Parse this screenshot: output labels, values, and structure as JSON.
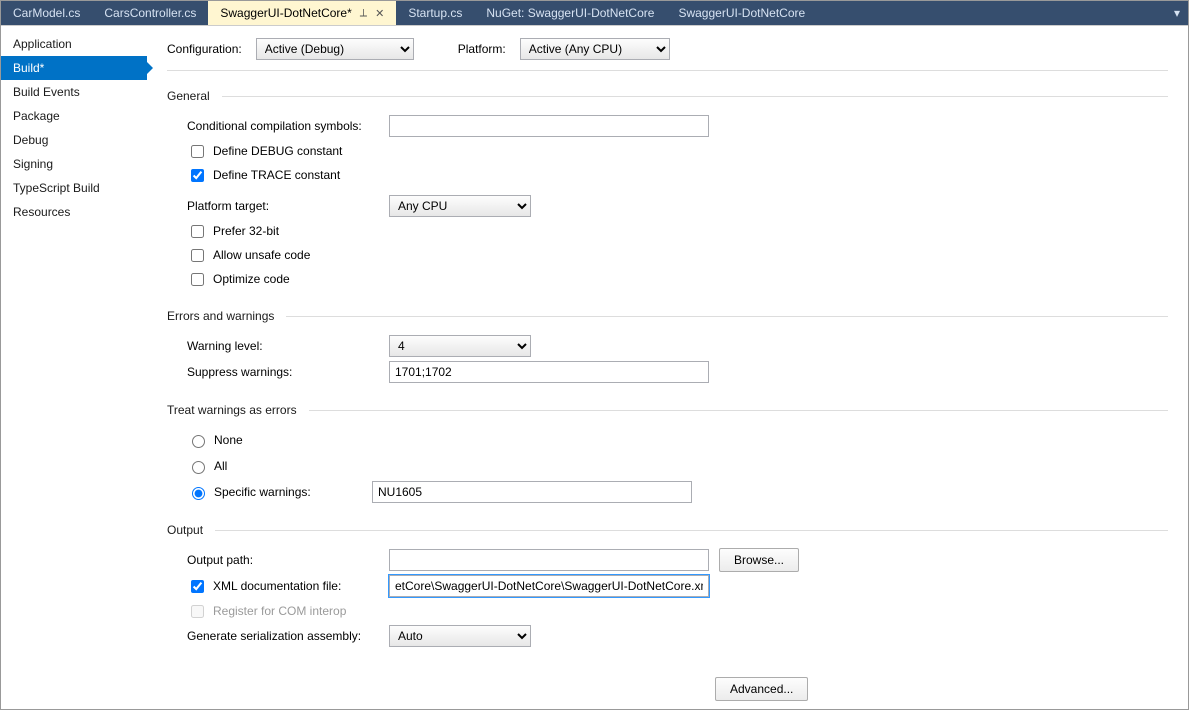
{
  "tabs": [
    {
      "label": "CarModel.cs",
      "active": false
    },
    {
      "label": "CarsController.cs",
      "active": false
    },
    {
      "label": "SwaggerUI-DotNetCore*",
      "active": true
    },
    {
      "label": "Startup.cs",
      "active": false
    },
    {
      "label": "NuGet: SwaggerUI-DotNetCore",
      "active": false
    },
    {
      "label": "SwaggerUI-DotNetCore",
      "active": false
    }
  ],
  "sidebar": {
    "items": [
      {
        "label": "Application",
        "active": false
      },
      {
        "label": "Build*",
        "active": true
      },
      {
        "label": "Build Events",
        "active": false
      },
      {
        "label": "Package",
        "active": false
      },
      {
        "label": "Debug",
        "active": false
      },
      {
        "label": "Signing",
        "active": false
      },
      {
        "label": "TypeScript Build",
        "active": false
      },
      {
        "label": "Resources",
        "active": false
      }
    ]
  },
  "top": {
    "configuration_label": "Configuration:",
    "configuration_value": "Active (Debug)",
    "platform_label": "Platform:",
    "platform_value": "Active (Any CPU)"
  },
  "general": {
    "title": "General",
    "cond_symbols_label": "Conditional compilation symbols:",
    "cond_symbols_value": "",
    "define_debug_label": "Define DEBUG constant",
    "define_debug_checked": false,
    "define_trace_label": "Define TRACE constant",
    "define_trace_checked": true,
    "platform_target_label": "Platform target:",
    "platform_target_value": "Any CPU",
    "prefer32_label": "Prefer 32-bit",
    "prefer32_checked": false,
    "allow_unsafe_label": "Allow unsafe code",
    "allow_unsafe_checked": false,
    "optimize_label": "Optimize code",
    "optimize_checked": false
  },
  "errors": {
    "title": "Errors and warnings",
    "warning_level_label": "Warning level:",
    "warning_level_value": "4",
    "suppress_label": "Suppress warnings:",
    "suppress_value": "1701;1702"
  },
  "treat": {
    "title": "Treat warnings as errors",
    "none_label": "None",
    "all_label": "All",
    "specific_label": "Specific warnings:",
    "specific_value": "NU1605",
    "selected": "specific"
  },
  "output": {
    "title": "Output",
    "output_path_label": "Output path:",
    "output_path_value": "",
    "browse_label": "Browse...",
    "xml_doc_label": "XML documentation file:",
    "xml_doc_checked": true,
    "xml_doc_value": "etCore\\SwaggerUI-DotNetCore\\SwaggerUI-DotNetCore.xml",
    "register_com_label": "Register for COM interop",
    "register_com_checked": false,
    "gen_serial_label": "Generate serialization assembly:",
    "gen_serial_value": "Auto",
    "advanced_label": "Advanced..."
  }
}
